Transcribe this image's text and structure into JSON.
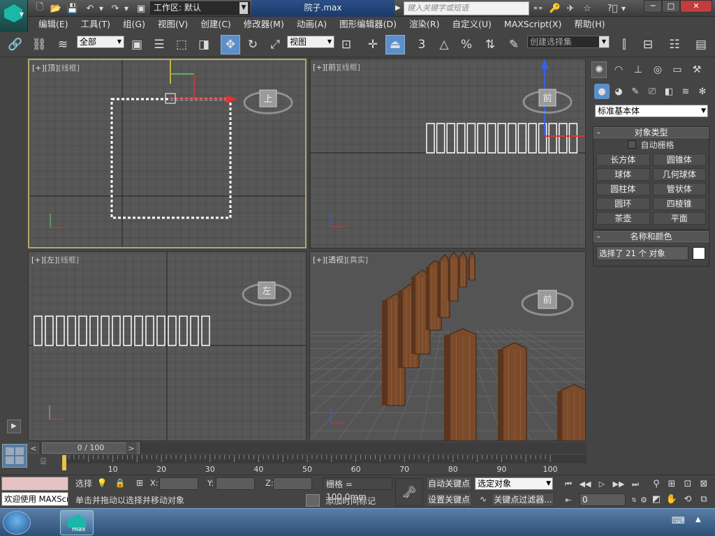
{
  "titlebar": {
    "workspace": "工作区: 默认",
    "doc_title": "院子.max",
    "search_placeholder": "键入关键字或短语",
    "win_min": "─",
    "win_max": "□",
    "win_close": "✕"
  },
  "menu": [
    "编辑(E)",
    "工具(T)",
    "组(G)",
    "视图(V)",
    "创建(C)",
    "修改器(M)",
    "动画(A)",
    "图形编辑器(D)",
    "渲染(R)",
    "自定义(U)",
    "MAXScript(X)",
    "帮助(H)"
  ],
  "toolbar": {
    "filter": "全部",
    "ref_coord": "视图",
    "snap_3": "3",
    "angle_snap": "△",
    "percent_snap": "%",
    "named_selection_placeholder": "创建选择集",
    "abc": "ABC"
  },
  "viewports": {
    "top": {
      "plus": "[+]",
      "name": "[顶]",
      "mode": "[线框]",
      "cube_label": "上"
    },
    "front": {
      "plus": "[+]",
      "name": "[前]",
      "mode": "[线框]",
      "cube_label": "前"
    },
    "left": {
      "plus": "[+]",
      "name": "[左]",
      "mode": "[线框]",
      "cube_label": "左"
    },
    "persp": {
      "plus": "[+]",
      "name": "[透视]",
      "mode": "[真实]",
      "cube_label": "前"
    }
  },
  "command_panel": {
    "primitive_type": "标准基本体",
    "object_type_title": "对象类型",
    "autogrid": "自动栅格",
    "objects": [
      "长方体",
      "圆锥体",
      "球体",
      "几何球体",
      "圆柱体",
      "管状体",
      "圆环",
      "四棱锥",
      "茶壶",
      "平面"
    ],
    "name_color_title": "名称和颜色",
    "name_value": "选择了 21 个 对象",
    "swatch_color": "#ffffff"
  },
  "timeline": {
    "frame_readout": "0 / 100",
    "ticks": [
      "10",
      "20",
      "30",
      "40",
      "50",
      "60",
      "70",
      "80",
      "90",
      "100"
    ]
  },
  "status": {
    "welcome": "欢迎使用 MAXScr",
    "selection": "选择",
    "x_label": "X:",
    "y_label": "Y:",
    "z_label": "Z:",
    "grid": "栅格 = 100.0mm",
    "prompt": "单击并拖动以选择并移动对象",
    "add_tag": "添加时间标记",
    "auto_key": "自动关键点",
    "set_key": "设置关键点",
    "key_filter_sel": "选定对象",
    "key_filters": "关键点过滤器...",
    "frame": "0"
  },
  "colors": {
    "viewport_bg": "#575757",
    "active_border": "#b8a76a",
    "accent_blue": "#5b8fc9",
    "wood": "#7a4a2a"
  }
}
